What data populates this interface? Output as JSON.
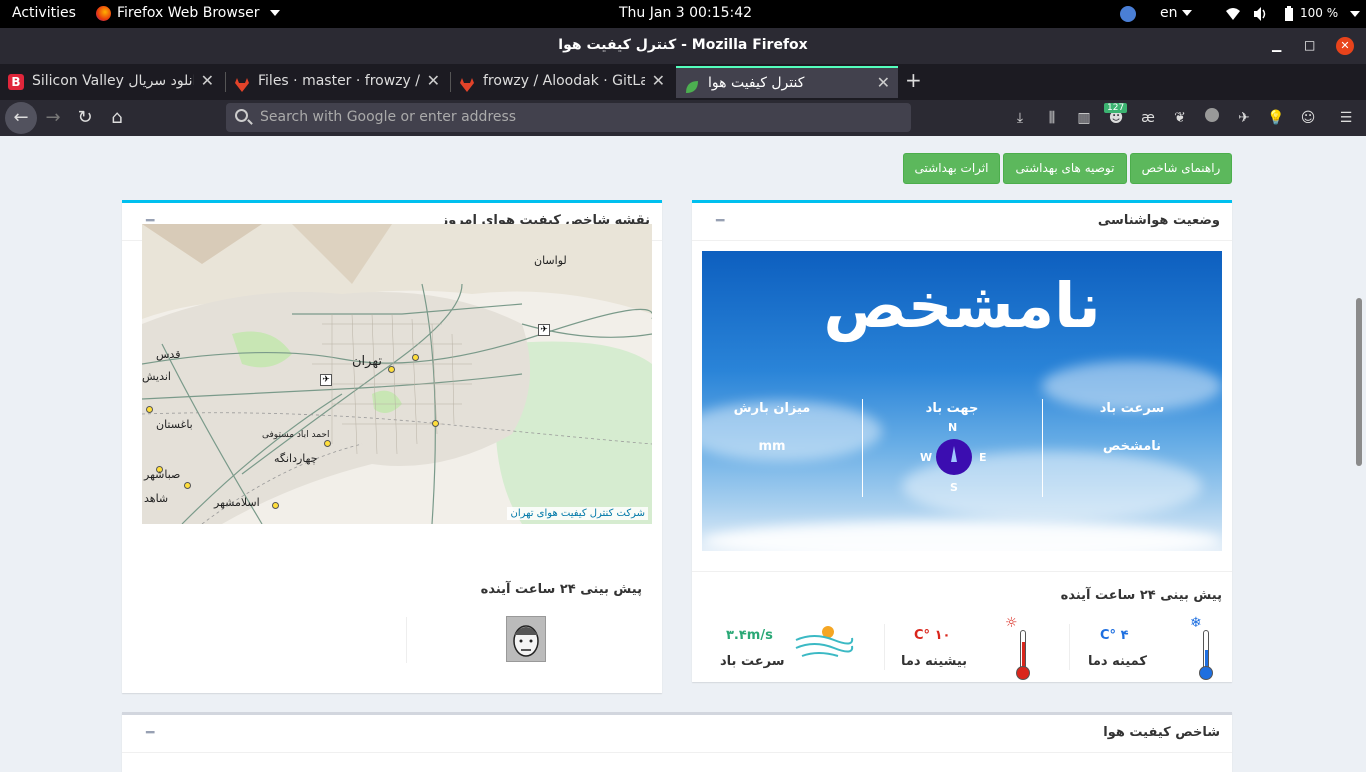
{
  "topbar": {
    "activities": "Activities",
    "app_name": "Firefox Web Browser",
    "clock": "Thu Jan 3  00:15:42",
    "lang": "en",
    "battery": "100 %"
  },
  "window": {
    "title": "کنترل کیفیت هوا - Mozilla Firefox"
  },
  "tabs": [
    {
      "label": "Silicon Valley دانلود سریال",
      "favicon_color": "#e0263b",
      "favicon_letter": "B"
    },
    {
      "label": "Files · master · frowzy / A",
      "favicon_color": "#e24329"
    },
    {
      "label": "frowzy / Aloodak · GitLab",
      "favicon_color": "#e24329"
    },
    {
      "label": "کنترل کیفیت هوا",
      "favicon_color": "#4caf50"
    }
  ],
  "navbar": {
    "url_placeholder": "Search with Google or enter address",
    "badge_count": "127"
  },
  "page": {
    "buttons": {
      "index_guide": "راهنمای شاخص",
      "health_tips": "توصیه های بهداشتی",
      "health_effects": "اثرات بهداشتی"
    },
    "weather_box": {
      "title": "وضعیت هواشناسی",
      "status": "نامشخص",
      "wind_speed_label": "سرعت باد",
      "wind_speed_value": "نامشخص",
      "wind_dir_label": "جهت باد",
      "precip_label": "میزان بارش",
      "precip_value": "mm",
      "compass": {
        "n": "N",
        "s": "S",
        "e": "E",
        "w": "W"
      },
      "forecast_title": "پیش بینی ۲۴ ساعت آینده",
      "min_temp_label": "کمینه دما",
      "min_temp_value": "۴ °C",
      "max_temp_label": "بیشینه دما",
      "max_temp_value": "۱۰ °C",
      "wind_label": "سرعت باد",
      "wind_value": "۳.۴m/s"
    },
    "map_box": {
      "title": "نقشه شاخص کیفیت هوای امروز",
      "attribution": "شرکت کنترل کیفیت هوای تهران",
      "places": [
        "لواسان",
        "تهران",
        "قدس",
        "باغستان",
        "چهاردانگه",
        "صباشهر",
        "اسلامشهر",
        "احمد اباد مستوفی",
        "اندیش",
        "شاهد"
      ],
      "forecast_title": "پیش بینی ۲۴ ساعت آینده"
    },
    "aqi_box": {
      "title": "شاخص کیفیت هوا"
    }
  }
}
